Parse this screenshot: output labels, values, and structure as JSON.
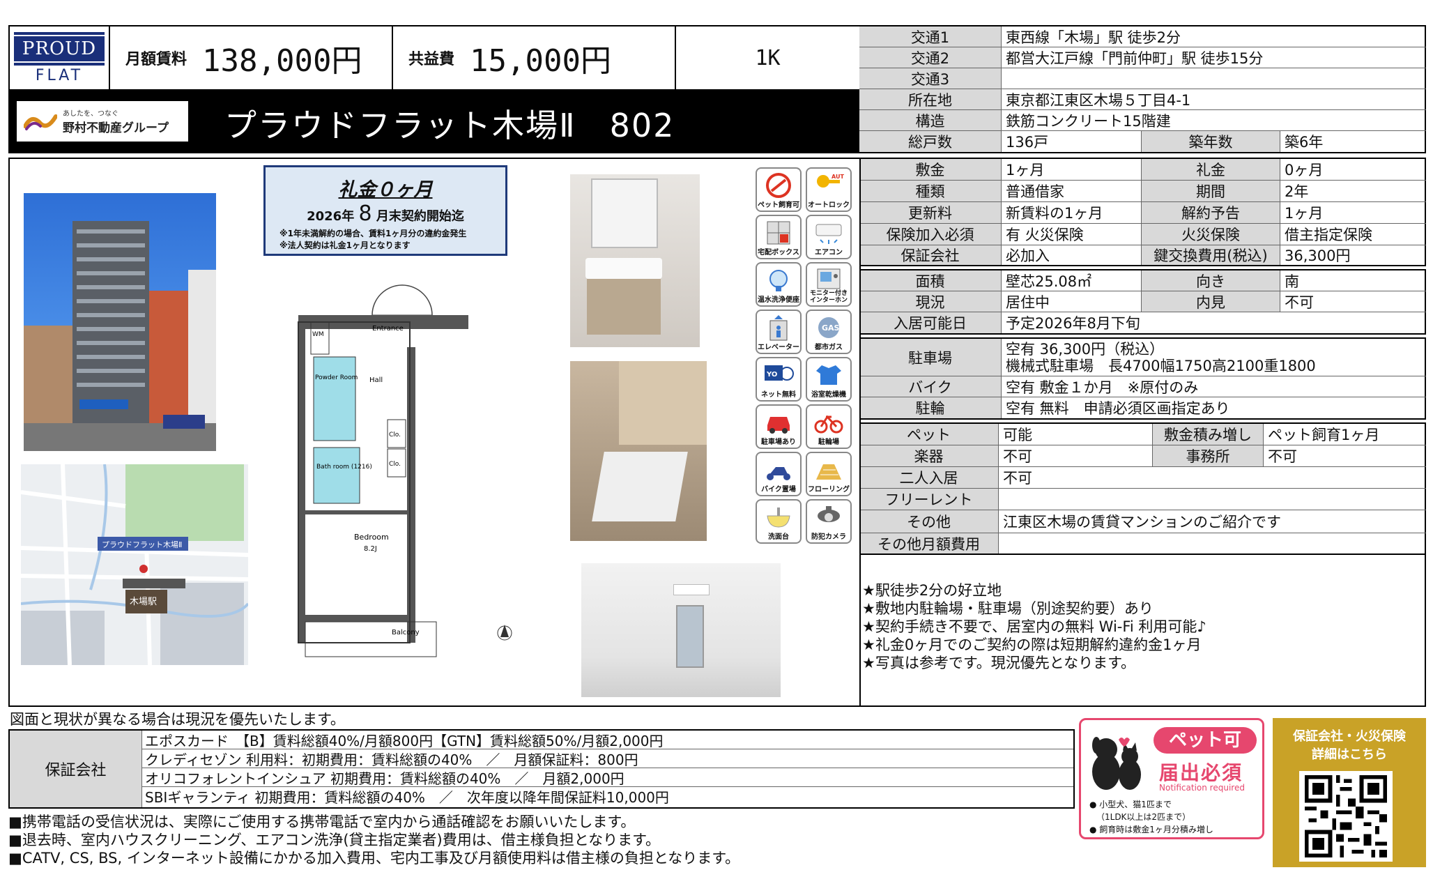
{
  "header": {
    "brand_top": "PROUD",
    "brand_bottom": "FLAT",
    "rent_label": "月額賃料",
    "rent_value": "138,000円",
    "fee_label": "共益費",
    "fee_value": "15,000円",
    "layout": "1K",
    "company_tagline": "あしたを、つなぐ",
    "company_name": "野村不動産グループ",
    "property_name": "プラウドフラット木場Ⅱ　802"
  },
  "access": [
    {
      "label": "交通1",
      "value": "東西線「木場」駅 徒歩2分"
    },
    {
      "label": "交通2",
      "value": "都営大江戸線「門前仲町」駅 徒歩15分"
    },
    {
      "label": "交通3",
      "value": ""
    }
  ],
  "building": {
    "address_label": "所在地",
    "address": "東京都江東区木場５丁目4-1",
    "structure_label": "構造",
    "structure": "鉄筋コンクリート15階建",
    "units_label": "総戸数",
    "units": "136戸",
    "age_label": "築年数",
    "age": "築6年"
  },
  "terms": {
    "deposit_label": "敷金",
    "deposit": "1ヶ月",
    "key_money_label": "礼金",
    "key_money": "0ヶ月",
    "type_label": "種類",
    "type": "普通借家",
    "period_label": "期間",
    "period": "2年",
    "renewal_label": "更新料",
    "renewal": "新賃料の1ヶ月",
    "notice_label": "解約予告",
    "notice": "1ヶ月",
    "insurance_req_label": "保険加入必須",
    "insurance_req": "有 火災保険",
    "fire_ins_label": "火災保険",
    "fire_ins": "借主指定保険",
    "guarantor_label": "保証会社",
    "guarantor": "必加入",
    "key_change_label": "鍵交換費用(税込)",
    "key_change": "36,300円"
  },
  "room": {
    "area_label": "面積",
    "area": "壁芯25.08㎡",
    "direction_label": "向き",
    "direction": "南",
    "status_label": "現況",
    "status": "居住中",
    "viewing_label": "内見",
    "viewing": "不可",
    "move_in_label": "入居可能日",
    "move_in": "予定2026年8月下旬"
  },
  "parking": {
    "car_label": "駐車場",
    "car_line1": "空有 36,300円（税込）",
    "car_line2": "機械式駐車場　長4700幅1750高2100重1800",
    "bike_label": "バイク",
    "bike": "空有 敷金１か月　※原付のみ",
    "bicycle_label": "駐輪",
    "bicycle": "空有 無料　申請必須区画指定あり"
  },
  "conditions": {
    "pet_label": "ペット",
    "pet": "可能",
    "extra_dep_label": "敷金積み増し",
    "extra_dep": "ペット飼育1ヶ月",
    "instrument_label": "楽器",
    "instrument": "不可",
    "office_label": "事務所",
    "office": "不可",
    "couple_label": "二人入居",
    "couple": "不可",
    "free_rent_label": "フリーレント",
    "free_rent": "",
    "other_label": "その他",
    "other": "江東区木場の賃貸マンションのご紹介です",
    "other_monthly_label": "その他月額費用",
    "other_monthly": ""
  },
  "highlights": [
    "★駅徒歩2分の好立地",
    "★敷地内駐輪場・駐車場（別途契約要）あり",
    "★契約手続き不要で、居室内の無料 Wi-Fi 利用可能♪",
    "★礼金0ヶ月でのご契約の際は短期解約違約金1ヶ月",
    "★写真は参考です。現況優先となります。"
  ],
  "campaign": {
    "title": "礼金０ヶ月",
    "year": "2026年",
    "month": "8",
    "suffix": "月末契約開始迄",
    "note1": "※1年未満解約の場合、賃料1ヶ月分の違約金発生",
    "note2": "※法人契約は礼金1ヶ月となります"
  },
  "floorplan": {
    "wm": "WM",
    "entrance": "Entrance",
    "powder": "Powder Room",
    "hall": "Hall",
    "bath": "Bath room (1216)",
    "closet": "Clo.",
    "bedroom": "Bedroom",
    "bedroom_size": "8.2J",
    "balcony": "Balcony"
  },
  "map": {
    "label1": "プラウドフラット木場Ⅱ",
    "station": "木場駅"
  },
  "amenities": [
    "ペット飼育可",
    "オートロック",
    "宅配ボックス",
    "エアコン",
    "温水洗浄便座",
    "モニター付きインターホン",
    "エレベーター",
    "都市ガス",
    "ネット無料",
    "浴室乾燥機",
    "駐車場あり",
    "駐輪場",
    "バイク置場",
    "フローリング",
    "洗面台",
    "防犯カメラ"
  ],
  "disclaimer": "図面と現状が異なる場合は現況を優先いたします。",
  "guarantee": {
    "label": "保証会社",
    "lines": [
      "エポスカード　【B】賃料総額40%/月額800円【GTN】賃料総額50%/月額2,000円",
      "クレディセゾン 利用料：初期費用：賃料総額の40%　／　月額保証料：800円",
      "オリコフォレントインシュア 初期費用：賃料総額の40%　／　月額2,000円",
      "SBIギャランティ 初期費用：賃料総額の40%　／　次年度以降年間保証料10,000円"
    ]
  },
  "pet_notice": {
    "badge": "ペット可",
    "required": "届出必須",
    "required_en": "Notification required",
    "note1": "● 小型犬、猫1匹まで",
    "note2": "（1LDK以上は2匹まで）",
    "note3": "● 飼育時は敷金1ヶ月分積み増し"
  },
  "qr_box": {
    "line1": "保証会社・火災保険",
    "line2": "詳細はこちら"
  },
  "footer": [
    "■携帯電話の受信状況は、実際にご使用する携帯電話で室内から通話確認をお願いいたします。",
    "■退去時、室内ハウスクリーニング、エアコン洗浄(貸主指定業者)費用は、借主様負担となります。",
    "■CATV, CS, BS, インターネット設備にかかる加入費用、宅内工事及び月額使用料は借主様の負担となります。"
  ],
  "colors": {
    "label_bg": "#d9d9d9",
    "brand_navy": "#1a2f7a",
    "pet_pink": "#e6476e",
    "qr_gold": "#c9a227"
  }
}
